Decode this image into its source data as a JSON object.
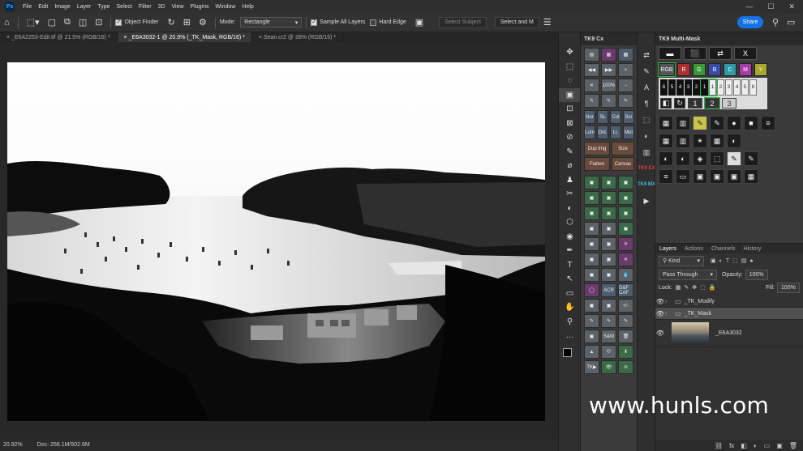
{
  "menubar": {
    "logo": "Ps",
    "items": [
      "File",
      "Edit",
      "Image",
      "Layer",
      "Type",
      "Select",
      "Filter",
      "3D",
      "View",
      "Plugins",
      "Window",
      "Help"
    ],
    "window_controls": [
      "—",
      "☐",
      "✕"
    ]
  },
  "options": {
    "object_finder": "Object Finder",
    "mode_label": "Mode:",
    "mode_value": "Rectangle",
    "sample_all_layers": "Sample All Layers",
    "hard_edge": "Hard Edge",
    "select_subject": "Select Subject",
    "select_and_mask": "Select and M",
    "share": "Share"
  },
  "tabs": [
    {
      "label": "_E6A2253-Edit.tif @ 21.5% (RGB/16) *",
      "close": "×"
    },
    {
      "label": "_E6A3032-1 @ 20.9% (_TK_Mask, RGB/16) *",
      "close": "×"
    },
    {
      "label": "Sean.cr2 @ 28% (RGB/16) *",
      "close": "×"
    }
  ],
  "status": {
    "zoom": "20.92%",
    "doc": "Doc: 256.1M/502.6M"
  },
  "tools": [
    "✥",
    "⬚",
    "◌",
    "▣",
    "⊡",
    "⊠",
    "⊘",
    "✎",
    "⌀",
    "♟",
    "✂",
    "◐",
    "⬡",
    "◉",
    "✒",
    "T",
    "↖",
    "▭",
    "✋",
    "⚲",
    "…"
  ],
  "cx_panel": {
    "title": "TK9 Cx",
    "rows": [
      [
        "▤",
        "▦",
        "▩"
      ],
      [
        "◀◀",
        "▶▶",
        "+"
      ],
      [
        "✕",
        "100%",
        "−"
      ],
      [
        "✎",
        "✎",
        "✎"
      ],
      [
        "Nor",
        "SL",
        "Col",
        "Scr"
      ],
      [
        "Lum",
        "OvL",
        "LL",
        "Mul"
      ],
      [
        "Dup Img",
        "Size"
      ],
      [
        "Flatten",
        "Canvas"
      ],
      [
        "▣",
        "▣",
        "▣"
      ],
      [
        "▣",
        "▣",
        "▣"
      ],
      [
        "▣",
        "▣",
        "▣"
      ],
      [
        "▣",
        "▣",
        "▣"
      ],
      [
        "▣",
        "▣",
        "✕"
      ],
      [
        "▣",
        "▣",
        "✕"
      ],
      [
        "▣",
        "▣",
        "💧"
      ],
      [
        "◯",
        "ACR",
        "D&F CAF"
      ],
      [
        "▣",
        "▣",
        "+/-"
      ],
      [
        "✎",
        "✎",
        "✎"
      ],
      [
        "▣",
        "S&M",
        "🗑"
      ],
      [
        "▲",
        "©",
        "⬇"
      ],
      [
        "TK▶",
        "👁",
        "≋"
      ]
    ]
  },
  "mid_icons": [
    "⇄",
    "✎",
    "A",
    "¶",
    "⬚",
    "◐",
    "▥",
    "TK9 EX",
    "TK9 MX",
    "▶"
  ],
  "multimask": {
    "title": "TK9 Multi-Mask",
    "top_buttons": [
      "▬",
      "⬛",
      "⇄",
      "X"
    ],
    "channels": [
      {
        "label": "RGB",
        "color": "#555555"
      },
      {
        "label": "R",
        "color": "#b03030"
      },
      {
        "label": "G",
        "color": "#3a9a3a"
      },
      {
        "label": "B",
        "color": "#3a4aa8"
      },
      {
        "label": "C",
        "color": "#2f9aa8"
      },
      {
        "label": "M",
        "color": "#a83aa8"
      },
      {
        "label": "Y",
        "color": "#a8a82f"
      }
    ],
    "zones_dark": [
      "6",
      "5",
      "4",
      "3",
      "2",
      "1"
    ],
    "zones_light": [
      "1",
      "2",
      "3",
      "4",
      "5",
      "6"
    ],
    "sub_row": [
      "◧",
      "↻",
      "1",
      "2",
      "3"
    ],
    "icon_rows": [
      [
        "▦",
        "▥",
        "✎",
        "✎",
        "●",
        "■",
        "≡"
      ],
      [
        "▦",
        "▥",
        "✴",
        "▦",
        "◐"
      ],
      [
        "◐",
        "◐",
        "◈",
        "⬚",
        "✎",
        "✎"
      ],
      [
        "≡",
        "▭",
        "▣",
        "▣",
        "▣",
        "▦"
      ]
    ]
  },
  "layers": {
    "tabs": [
      "Layers",
      "Actions",
      "Channels",
      "History"
    ],
    "kind": "Kind",
    "blend": "Pass Through",
    "opacity_label": "Opacity:",
    "opacity": "100%",
    "lock_label": "Lock:",
    "fill_label": "Fill:",
    "fill": "100%",
    "items": [
      {
        "name": "_TK_Modify",
        "type": "folder"
      },
      {
        "name": "_TK_Mask",
        "type": "folder"
      },
      {
        "name": "_E6A3032",
        "type": "image"
      }
    ],
    "bottom_icons": [
      "⛓",
      "fx",
      "◧",
      "◐",
      "▭",
      "▣",
      "🗑"
    ]
  },
  "watermark": "www.hunls.com"
}
